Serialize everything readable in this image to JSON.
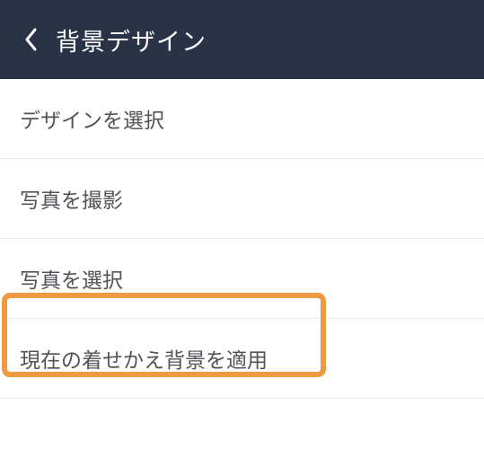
{
  "header": {
    "title": "背景デザイン"
  },
  "list": {
    "items": [
      {
        "label": "デザインを選択"
      },
      {
        "label": "写真を撮影"
      },
      {
        "label": "写真を選択"
      },
      {
        "label": "現在の着せかえ背景を適用"
      }
    ]
  },
  "highlight": {
    "color": "#ed9a40"
  }
}
